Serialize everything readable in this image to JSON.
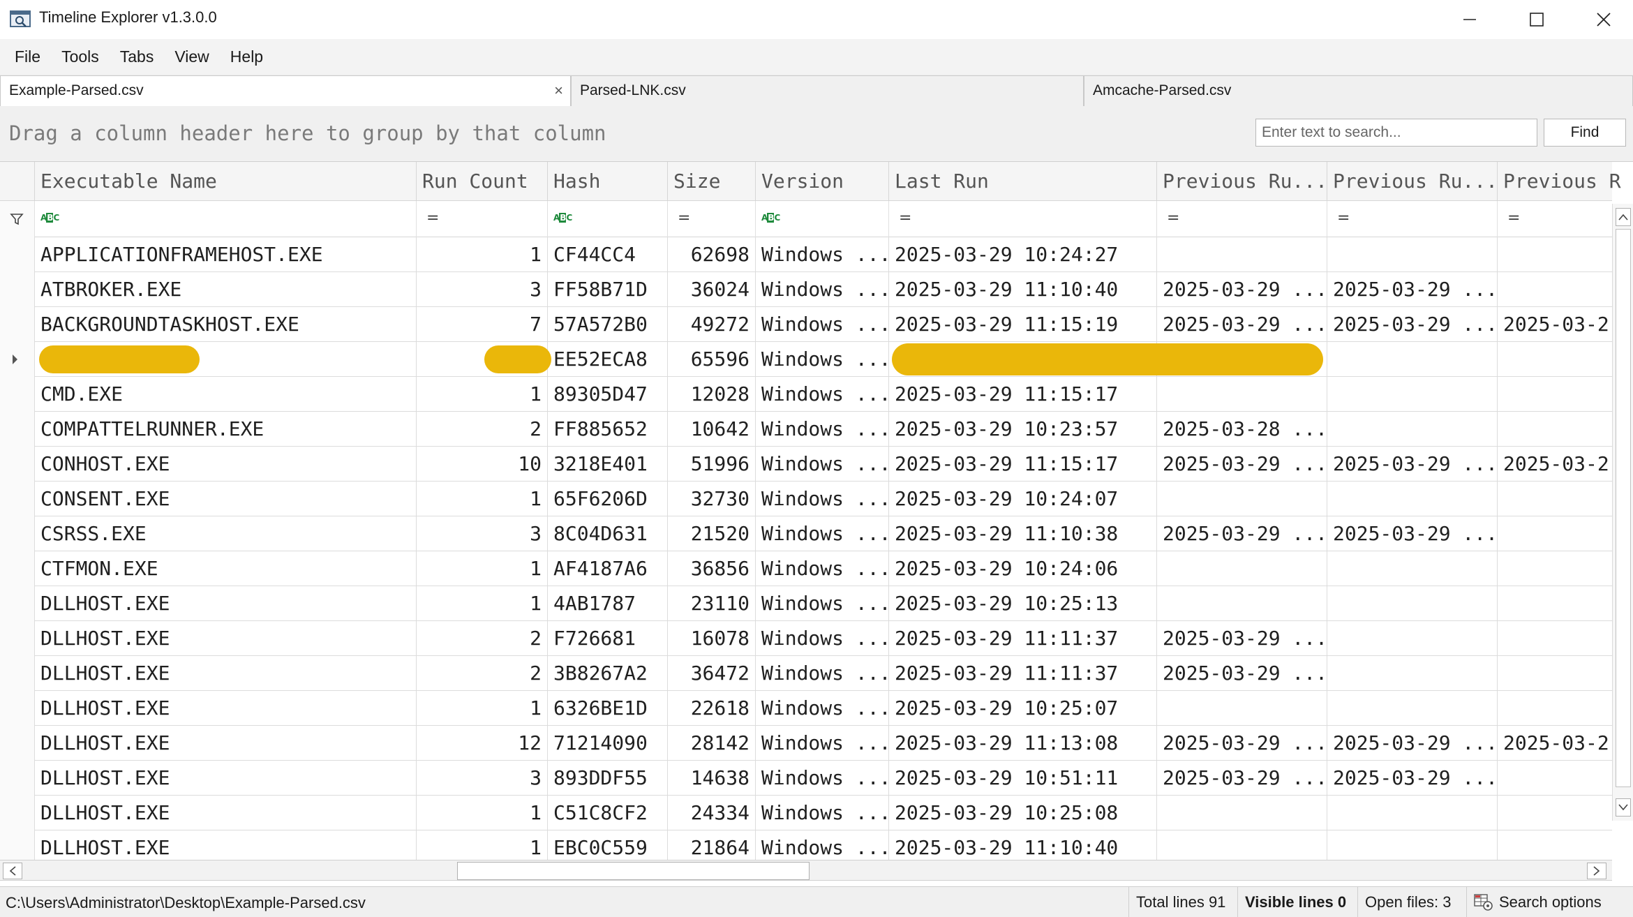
{
  "window": {
    "title": "Timeline Explorer v1.3.0.0"
  },
  "menu": {
    "items": [
      "File",
      "Tools",
      "Tabs",
      "View",
      "Help"
    ]
  },
  "tabs": [
    {
      "label": "Example-Parsed.csv",
      "active": true
    },
    {
      "label": "Parsed-LNK.csv",
      "active": false
    },
    {
      "label": "Amcache-Parsed.csv",
      "active": false
    }
  ],
  "grouping": {
    "hint": "Drag a column header here to group by that column"
  },
  "search": {
    "placeholder": "Enter text to search...",
    "find_label": "Find"
  },
  "columns": [
    "Executable Name",
    "Run Count",
    "Hash",
    "Size",
    "Version",
    "Last Run",
    "Previous Ru...",
    "Previous Ru...",
    "Previous R"
  ],
  "filter_icons": [
    "abc",
    "=",
    "abc",
    "=",
    "abc",
    "=",
    "=",
    "=",
    "="
  ],
  "rows": [
    {
      "name": "APPLICATIONFRAMEHOST.EXE",
      "count": "1",
      "hash": "CF44CC4",
      "size": "62698",
      "version": "Windows ...",
      "last": "2025-03-29 10:24:27",
      "p1": "",
      "p2": "",
      "p3": ""
    },
    {
      "name": "ATBROKER.EXE",
      "count": "3",
      "hash": "FF58B71D",
      "size": "36024",
      "version": "Windows ...",
      "last": "2025-03-29 11:10:40",
      "p1": "2025-03-29 ...",
      "p2": "2025-03-29 ...",
      "p3": ""
    },
    {
      "name": "BACKGROUNDTASKHOST.EXE",
      "count": "7",
      "hash": "57A572B0",
      "size": "49272",
      "version": "Windows ...",
      "last": "2025-03-29 11:15:19",
      "p1": "2025-03-29 ...",
      "p2": "2025-03-29 ...",
      "p3": "2025-03-2"
    },
    {
      "name": "",
      "count": "",
      "hash": "EE52ECA8",
      "size": "65596",
      "version": "Windows ...",
      "last": "",
      "p1": "",
      "p2": "",
      "p3": "",
      "redacted": true,
      "selected": true
    },
    {
      "name": "CMD.EXE",
      "count": "1",
      "hash": "89305D47",
      "size": "12028",
      "version": "Windows ...",
      "last": "2025-03-29 11:15:17",
      "p1": "",
      "p2": "",
      "p3": ""
    },
    {
      "name": "COMPATTELRUNNER.EXE",
      "count": "2",
      "hash": "FF885652",
      "size": "10642",
      "version": "Windows ...",
      "last": "2025-03-29 10:23:57",
      "p1": "2025-03-28 ...",
      "p2": "",
      "p3": ""
    },
    {
      "name": "CONHOST.EXE",
      "count": "10",
      "hash": "3218E401",
      "size": "51996",
      "version": "Windows ...",
      "last": "2025-03-29 11:15:17",
      "p1": "2025-03-29 ...",
      "p2": "2025-03-29 ...",
      "p3": "2025-03-2"
    },
    {
      "name": "CONSENT.EXE",
      "count": "1",
      "hash": "65F6206D",
      "size": "32730",
      "version": "Windows ...",
      "last": "2025-03-29 10:24:07",
      "p1": "",
      "p2": "",
      "p3": ""
    },
    {
      "name": "CSRSS.EXE",
      "count": "3",
      "hash": "8C04D631",
      "size": "21520",
      "version": "Windows ...",
      "last": "2025-03-29 11:10:38",
      "p1": "2025-03-29 ...",
      "p2": "2025-03-29 ...",
      "p3": ""
    },
    {
      "name": "CTFMON.EXE",
      "count": "1",
      "hash": "AF4187A6",
      "size": "36856",
      "version": "Windows ...",
      "last": "2025-03-29 10:24:06",
      "p1": "",
      "p2": "",
      "p3": ""
    },
    {
      "name": "DLLHOST.EXE",
      "count": "1",
      "hash": "4AB1787",
      "size": "23110",
      "version": "Windows ...",
      "last": "2025-03-29 10:25:13",
      "p1": "",
      "p2": "",
      "p3": ""
    },
    {
      "name": "DLLHOST.EXE",
      "count": "2",
      "hash": "F726681",
      "size": "16078",
      "version": "Windows ...",
      "last": "2025-03-29 11:11:37",
      "p1": "2025-03-29 ...",
      "p2": "",
      "p3": ""
    },
    {
      "name": "DLLHOST.EXE",
      "count": "2",
      "hash": "3B8267A2",
      "size": "36472",
      "version": "Windows ...",
      "last": "2025-03-29 11:11:37",
      "p1": "2025-03-29 ...",
      "p2": "",
      "p3": ""
    },
    {
      "name": "DLLHOST.EXE",
      "count": "1",
      "hash": "6326BE1D",
      "size": "22618",
      "version": "Windows ...",
      "last": "2025-03-29 10:25:07",
      "p1": "",
      "p2": "",
      "p3": ""
    },
    {
      "name": "DLLHOST.EXE",
      "count": "12",
      "hash": "71214090",
      "size": "28142",
      "version": "Windows ...",
      "last": "2025-03-29 11:13:08",
      "p1": "2025-03-29 ...",
      "p2": "2025-03-29 ...",
      "p3": "2025-03-2"
    },
    {
      "name": "DLLHOST.EXE",
      "count": "3",
      "hash": "893DDF55",
      "size": "14638",
      "version": "Windows ...",
      "last": "2025-03-29 10:51:11",
      "p1": "2025-03-29 ...",
      "p2": "2025-03-29 ...",
      "p3": ""
    },
    {
      "name": "DLLHOST.EXE",
      "count": "1",
      "hash": "C51C8CF2",
      "size": "24334",
      "version": "Windows ...",
      "last": "2025-03-29 10:25:08",
      "p1": "",
      "p2": "",
      "p3": ""
    },
    {
      "name": "DLLHOST.EXE",
      "count": "1",
      "hash": "EBC0C559",
      "size": "21864",
      "version": "Windows ...",
      "last": "2025-03-29 11:10:40",
      "p1": "",
      "p2": "",
      "p3": ""
    }
  ],
  "status": {
    "path": "C:\\Users\\Administrator\\Desktop\\Example-Parsed.csv",
    "total_lines": "Total lines 91",
    "visible_lines": "Visible lines 0",
    "open_files": "Open files: 3",
    "search_options": "Search options"
  },
  "colors": {
    "redaction": "#eab70a",
    "abc_green": "#1e8a3c"
  }
}
